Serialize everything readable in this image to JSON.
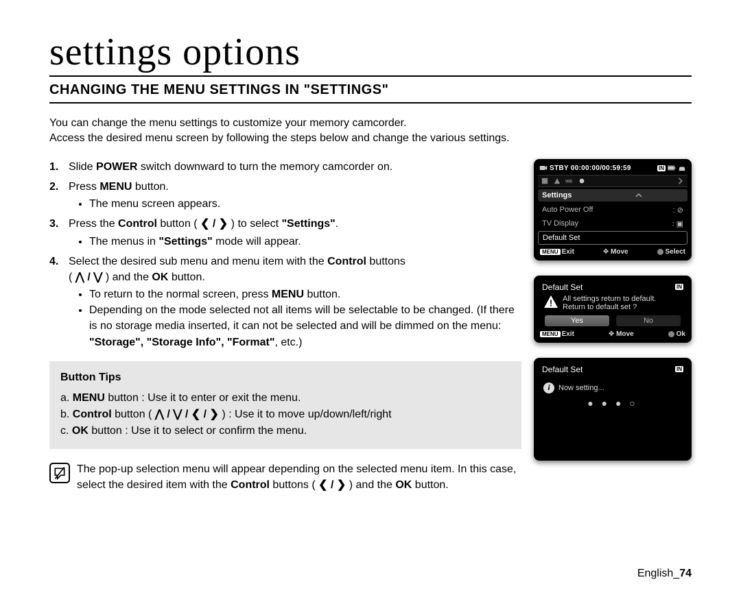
{
  "page": {
    "title": "settings options",
    "subtitle": "CHANGING THE MENU SETTINGS IN \"SETTINGS\"",
    "intro_line1": "You can change the menu settings to customize your memory camcorder.",
    "intro_line2": "Access the desired menu screen by following the steps below and change the various settings.",
    "footer_lang": "English",
    "footer_page": "74"
  },
  "steps": {
    "s1": {
      "num": "1.",
      "a": "Slide ",
      "b": "POWER",
      "c": " switch downward to turn the memory camcorder on."
    },
    "s2": {
      "num": "2.",
      "a": "Press ",
      "b": "MENU",
      "c": " button.",
      "sub1": "The menu screen appears."
    },
    "s3": {
      "num": "3.",
      "a": "Press the ",
      "b": "Control",
      "c": " button ( ",
      "lr": "❮ / ❯",
      "d": " ) to select ",
      "e": "\"Settings\"",
      "f": ".",
      "sub1_a": "The menus in ",
      "sub1_b": "\"Settings\"",
      "sub1_c": " mode will appear."
    },
    "s4": {
      "num": "4.",
      "a": "Select the desired sub menu and menu item with the ",
      "b": "Control",
      "c": " buttons",
      "line2_a": "( ",
      "ud": "❰⋀ / ⋁❱",
      "line2_b": " ) and the ",
      "line2_c": "OK",
      "line2_d": " button.",
      "sub1_a": "To return to the normal screen, press ",
      "sub1_b": "MENU",
      "sub1_c": " button.",
      "sub2": "Depending on the mode selected not all items will be selectable to be changed. (If there is no storage media inserted, it can not be selected and will be dimmed on the menu: ",
      "sub2_b": "\"Storage\", \"Storage Info\", \"Format\"",
      "sub2_c": ", etc.)"
    }
  },
  "tips": {
    "title": "Button Tips",
    "a_pre": "a.  ",
    "a_b": "MENU",
    "a_post": " button : Use it to enter or exit the menu.",
    "b_pre": "b.  ",
    "b_b": "Control",
    "b_mid": " button ( ",
    "b_arrows": "⋀ / ⋁ / ❮ / ❯",
    "b_post": " ) : Use it to move up/down/left/right",
    "c_pre": "c.  ",
    "c_b": "OK",
    "c_post": " button : Use it to select or confirm the menu."
  },
  "note": {
    "text_a": "The pop-up selection menu will appear depending on the selected menu item. In this case, select the desired item with the ",
    "text_b": "Control",
    "text_c": " buttons ( ",
    "arrows": "❮ / ❯",
    "text_d": " ) and the ",
    "text_e": "OK",
    "text_f": " button."
  },
  "lcd1": {
    "stby": "STBY 00:00:00/00:59:59",
    "in": "IN",
    "heading": "Settings",
    "row1": "Auto Power Off",
    "row2": "TV Display",
    "row3": "Default Set",
    "hint_exit": "Exit",
    "hint_move": "Move",
    "hint_select": "Select",
    "menu": "MENU"
  },
  "lcd2": {
    "title": "Default Set",
    "in": "IN",
    "line1": "All settings return to default.",
    "line2": "Return to default set ?",
    "yes": "Yes",
    "no": "No",
    "hint_exit": "Exit",
    "hint_move": "Move",
    "hint_ok": "Ok",
    "menu": "MENU"
  },
  "lcd3": {
    "title": "Default Set",
    "in": "IN",
    "msg": "Now setting...",
    "dots": "● ● ● ○"
  }
}
